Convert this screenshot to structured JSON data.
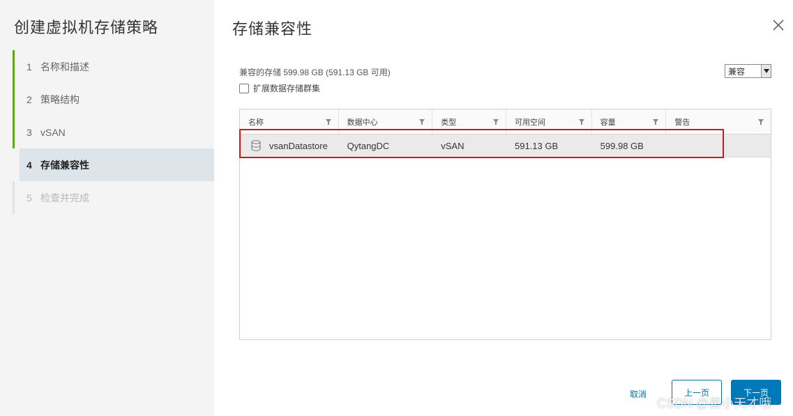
{
  "wizard": {
    "title": "创建虚拟机存储策略",
    "steps": [
      {
        "num": "1",
        "label": "名称和描述"
      },
      {
        "num": "2",
        "label": "策略结构"
      },
      {
        "num": "3",
        "label": "vSAN"
      },
      {
        "num": "4",
        "label": "存储兼容性"
      },
      {
        "num": "5",
        "label": "检查并完成"
      }
    ]
  },
  "page": {
    "title": "存储兼容性",
    "summary": "兼容的存储 599.98 GB (591.13 GB 可用)",
    "filter_value": "兼容",
    "expand_label": "扩展数据存储群集"
  },
  "grid": {
    "columns": [
      "名称",
      "数据中心",
      "类型",
      "可用空间",
      "容量",
      "警告"
    ],
    "rows": [
      {
        "name": "vsanDatastore",
        "datacenter": "QytangDC",
        "type": "vSAN",
        "free": "591.13 GB",
        "capacity": "599.98 GB",
        "warning": ""
      }
    ]
  },
  "footer": {
    "cancel": "取消",
    "back": "上一页",
    "next": "下一页"
  },
  "watermark": "CSDN @是小天才哦",
  "colors": {
    "accent": "#0079b8",
    "step_done": "#62a420",
    "highlight": "#d01818"
  },
  "icons": {
    "close": "close-icon",
    "filter": "filter-icon",
    "datastore": "database-icon"
  }
}
